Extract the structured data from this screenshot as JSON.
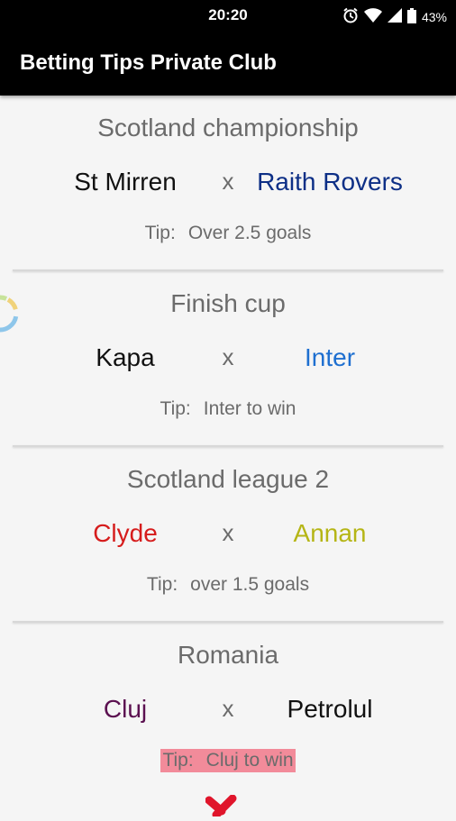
{
  "status": {
    "time": "20:20",
    "battery": "43%"
  },
  "app": {
    "title": "Betting Tips Private Club"
  },
  "tip_label": "Tip:",
  "vs": "x",
  "matches": [
    {
      "league": "Scotland championship",
      "home": "St Mirren",
      "away": "Raith Rovers",
      "tip": "Over 2.5 goals",
      "home_color": "#111111",
      "away_color": "#0d2f86",
      "tip_bg": ""
    },
    {
      "league": "Finish cup",
      "home": "Kapa",
      "away": "Inter",
      "tip": "Inter to win",
      "home_color": "#111111",
      "away_color": "#1e6fd0",
      "tip_bg": ""
    },
    {
      "league": "Scotland league 2",
      "home": "Clyde",
      "away": "Annan",
      "tip": "over 1.5 goals",
      "home_color": "#d61c1c",
      "away_color": "#b5b515",
      "tip_bg": ""
    },
    {
      "league": "Romania",
      "home": "Cluj",
      "away": "Petrolul",
      "tip": "Cluj to win",
      "home_color": "#5b1050",
      "away_color": "#111111",
      "tip_bg": "#f28b9a"
    }
  ],
  "icons": {
    "alarm": "alarm-icon",
    "wifi": "wifi-icon",
    "signal": "signal-icon",
    "battery": "battery-icon",
    "loading": "loading-spinner-icon",
    "result": "red-x-mark-icon"
  }
}
